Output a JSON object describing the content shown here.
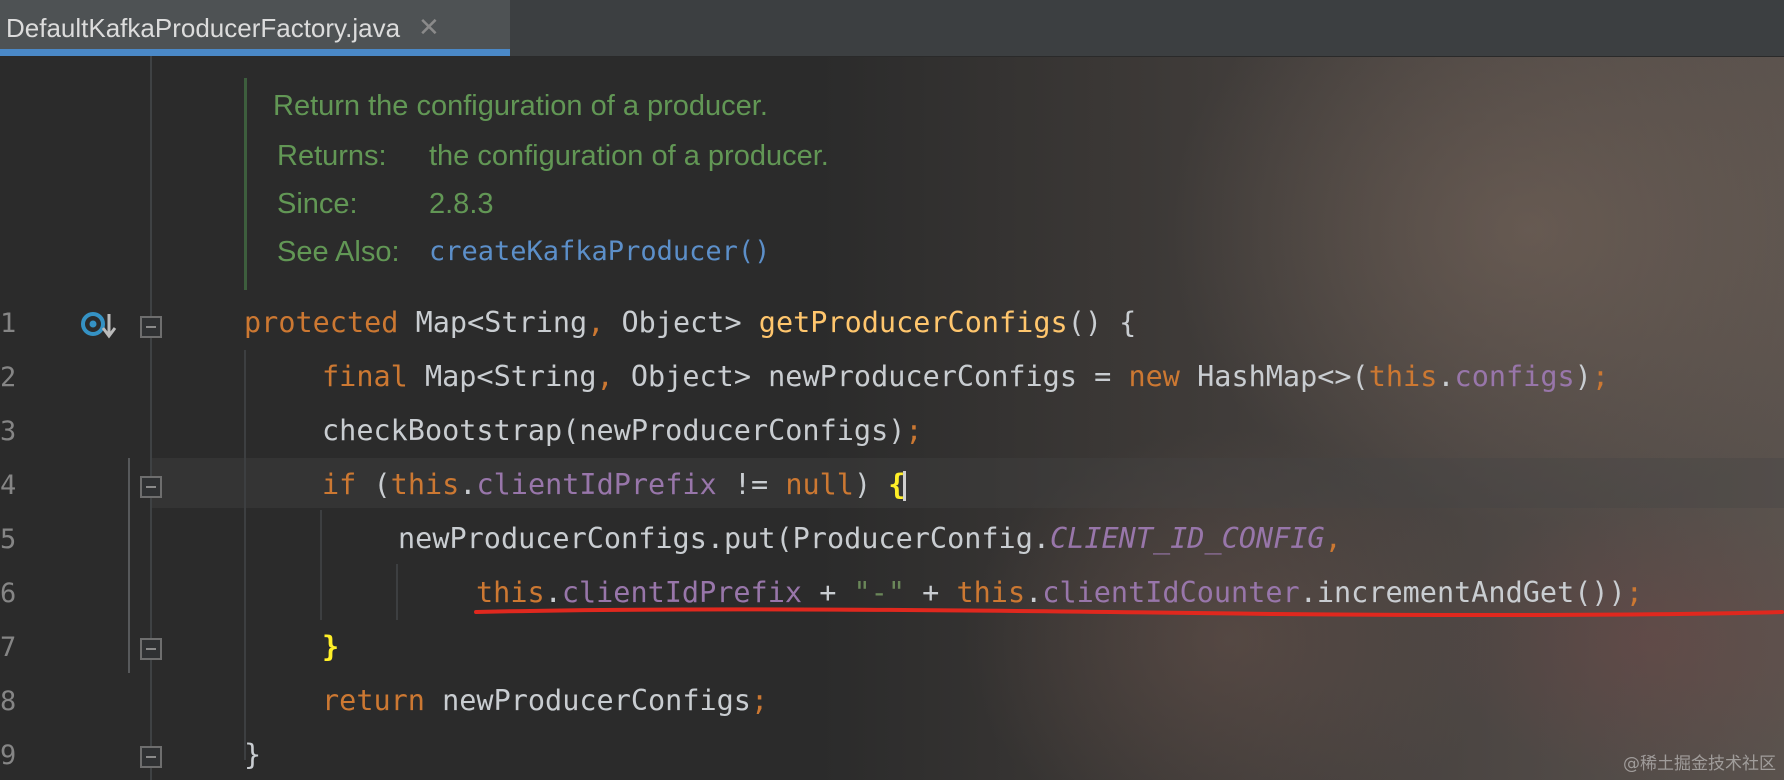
{
  "tab": {
    "filename": "DefaultKafkaProducerFactory.java",
    "close_glyph": "✕"
  },
  "gutter": {
    "line_numbers": [
      "1",
      "2",
      "3",
      "4",
      "5",
      "6",
      "7",
      "8",
      "9"
    ],
    "implements_icon": "implemented-method-icon"
  },
  "javadoc": {
    "summary": "Return the configuration of a producer.",
    "returns_key": "Returns:",
    "returns_val": "the configuration of a producer.",
    "since_key": "Since:",
    "since_val": "2.8.3",
    "see_also_key": "See Also:",
    "see_also_link": "createKafkaProducer()"
  },
  "code": {
    "l1": {
      "kw": "protected",
      "t1": " Map<String",
      "p1": ",",
      "t2": " Object> ",
      "fn": "getProducerConfigs",
      "t3": "() {"
    },
    "l2": {
      "kw": "final",
      "t1": " Map<String",
      "p1": ",",
      "t2": " Object> newProducerConfigs = ",
      "kw2": "new",
      "t3": " HashMap<>(",
      "this": "this",
      "dot": ".",
      "fld": "configs",
      "t4": ")",
      "semi": ";"
    },
    "l3": {
      "t1": "checkBootstrap(newProducerConfigs)",
      "semi": ";"
    },
    "l4": {
      "kw": "if",
      "t1": " (",
      "this": "this",
      "dot": ".",
      "fld": "clientIdPrefix",
      "t2": " != ",
      "nul": "null",
      "t3": ") ",
      "brace": "{"
    },
    "l5": {
      "t1": "newProducerConfigs.put(ProducerConfig.",
      "cst": "CLIENT_ID_CONFIG",
      "comma": ","
    },
    "l6": {
      "this1": "this",
      "dot1": ".",
      "fld1": "clientIdPrefix",
      "t1": " + ",
      "str": "\"-\"",
      "t2": " + ",
      "this2": "this",
      "dot2": ".",
      "fld2": "clientIdCounter",
      "t3": ".incrementAndGet())",
      "semi": ";"
    },
    "l7": {
      "brace": "}"
    },
    "l8": {
      "kw": "return",
      "t1": " newProducerConfigs",
      "semi": ";"
    },
    "l9": {
      "brace": "}"
    }
  },
  "watermark": "@稀土掘金技术社区",
  "colors": {
    "keyword": "#cc7832",
    "method": "#ffc66d",
    "field": "#9876aa",
    "string": "#6a8759",
    "doc": "#629755",
    "link": "#5c8fc9",
    "annotation_red": "#e0281e"
  }
}
